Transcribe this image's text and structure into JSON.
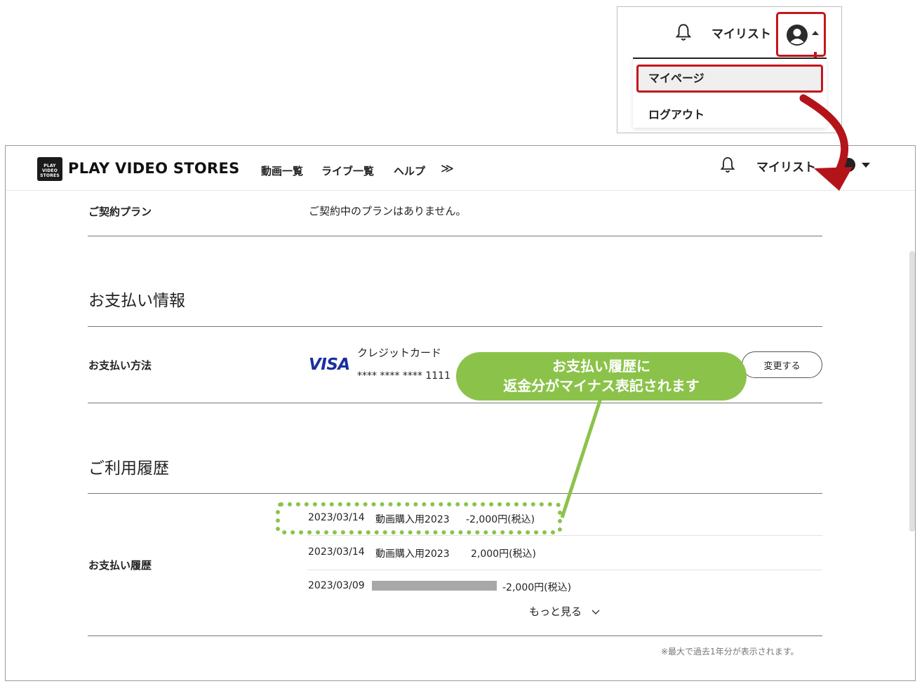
{
  "inset": {
    "mylist": "マイリスト",
    "menu": {
      "mypage": "マイページ",
      "logout": "ログアウト"
    }
  },
  "header": {
    "logo_mark_lines": [
      "PLAY",
      "VIDEO",
      "STORES"
    ],
    "logo_text": "PLAY VIDEO STORES",
    "nav": {
      "videos": "動画一覧",
      "lives": "ライブ一覧",
      "help": "ヘルプ",
      "more": "≫"
    },
    "mylist": "マイリスト"
  },
  "plan": {
    "label": "ご契約プラン",
    "value": "ご契約中のプランはありません。"
  },
  "payment_info": {
    "title": "お支払い情報",
    "method_label": "お支払い方法",
    "card_brand": "VISA",
    "card_type": "クレジットカード",
    "card_number": "**** **** **** 1111",
    "change_button": "変更する"
  },
  "callout": {
    "line1": "お支払い履歴に",
    "line2": "返金分がマイナス表記されます"
  },
  "usage_history": {
    "title": "ご利用履歴",
    "history_label": "お支払い履歴",
    "rows": [
      {
        "date": "2023/03/14",
        "item": "動画購入用2023",
        "amount": "-2,000円(税込)"
      },
      {
        "date": "2023/03/14",
        "item": "動画購入用2023",
        "amount": "2,000円(税込)"
      },
      {
        "date": "2023/03/09",
        "item": "",
        "amount": "-2,000円(税込)"
      }
    ],
    "more": "もっと見る",
    "note": "※最大で過去1年分が表示されます。"
  },
  "colors": {
    "highlight_red": "#c4161c",
    "callout_green": "#8bc34a",
    "visa_blue": "#1a2fa0"
  }
}
